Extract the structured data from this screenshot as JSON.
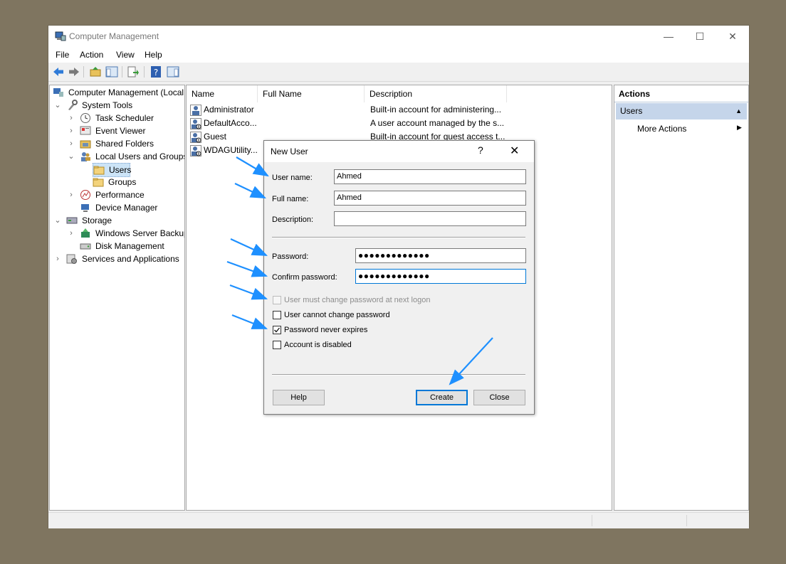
{
  "window": {
    "title": "Computer Management",
    "controls": {
      "minimize": "—",
      "maximize": "☐",
      "close": "✕"
    }
  },
  "menu": [
    "File",
    "Action",
    "View",
    "Help"
  ],
  "tree": {
    "items": [
      {
        "label": "Computer Management (Local",
        "icon": "computer-management-icon"
      },
      {
        "label": "System Tools",
        "icon": "tools-icon"
      },
      {
        "label": "Task Scheduler",
        "icon": "clock-icon"
      },
      {
        "label": "Event Viewer",
        "icon": "event-viewer-icon"
      },
      {
        "label": "Shared Folders",
        "icon": "shared-folder-icon"
      },
      {
        "label": "Local Users and Groups",
        "icon": "users-groups-icon"
      },
      {
        "label": "Users",
        "icon": "folder-icon"
      },
      {
        "label": "Groups",
        "icon": "folder-icon"
      },
      {
        "label": "Performance",
        "icon": "performance-icon"
      },
      {
        "label": "Device Manager",
        "icon": "device-manager-icon"
      },
      {
        "label": "Storage",
        "icon": "storage-icon"
      },
      {
        "label": "Windows Server Backup",
        "icon": "backup-icon"
      },
      {
        "label": "Disk Management",
        "icon": "disk-icon"
      },
      {
        "label": "Services and Applications",
        "icon": "services-icon"
      }
    ]
  },
  "list": {
    "columns": [
      "Name",
      "Full Name",
      "Description"
    ],
    "rows": [
      {
        "name": "Administrator",
        "full_name": "",
        "description": "Built-in account for administering..."
      },
      {
        "name": "DefaultAcco...",
        "full_name": "",
        "description": "A user account managed by the s..."
      },
      {
        "name": "Guest",
        "full_name": "",
        "description": "Built-in account for guest access t..."
      },
      {
        "name": "WDAGUtility...",
        "full_name": "",
        "description": ""
      }
    ]
  },
  "actions": {
    "header": "Actions",
    "section": "Users",
    "more": "More Actions"
  },
  "dialog": {
    "title": "New User",
    "help_glyph": "?",
    "close_glyph": "✕",
    "username_label": "User name:",
    "username_value": "Ahmed",
    "fullname_label": "Full name:",
    "fullname_value": "Ahmed",
    "description_label": "Description:",
    "description_value": "",
    "password_label": "Password:",
    "password_value": "●●●●●●●●●●●●●",
    "confirm_label": "Confirm password:",
    "confirm_value": "●●●●●●●●●●●●●",
    "options": [
      {
        "label": "User must change password at next logon",
        "checked": false,
        "disabled": true
      },
      {
        "label": "User cannot change password",
        "checked": false,
        "disabled": false
      },
      {
        "label": "Password never expires",
        "checked": true,
        "disabled": false
      },
      {
        "label": "Account is disabled",
        "checked": false,
        "disabled": false
      }
    ],
    "help_button": "Help",
    "create_button": "Create",
    "close_button": "Close"
  },
  "colors": {
    "annotation_arrow": "#1e90ff",
    "selection": "#c5d5ea",
    "focus_border": "#0078d7"
  }
}
